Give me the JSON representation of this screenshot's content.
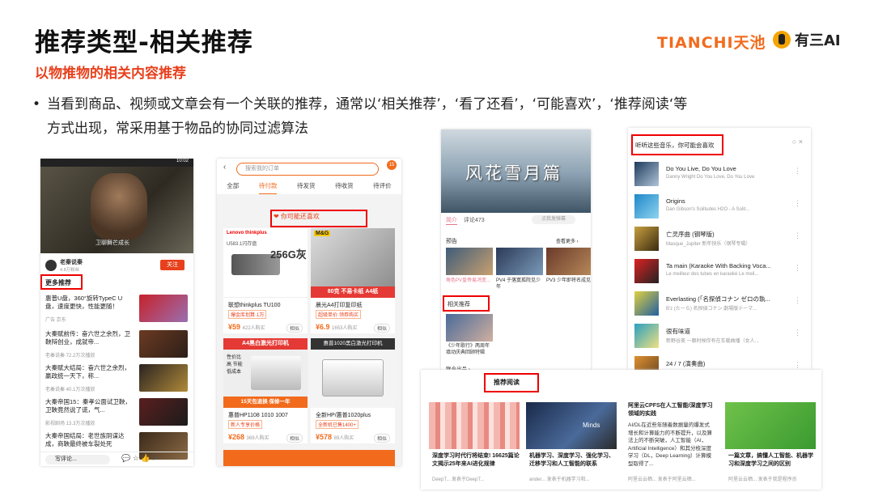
{
  "slide": {
    "title": "推荐类型-相关推荐",
    "subtitle": "以物推物的相关内容推荐",
    "logo_tianchi": "TIANCHI天池",
    "logo_yousan": "有三AI",
    "bullet_line1": "当看到商品、视频或文章会有一个关联的推荐，通常以‘相关推荐’，‘看了还看’，‘可能喜欢’，‘推荐阅读‘等",
    "bullet_line2": "方式出现，常采用基于物品的协同过滤算法"
  },
  "s1": {
    "status_time": "10:02",
    "video_caption": "卫聊舞芒成长",
    "channel": "老秦说秦",
    "followers": "4.8万粉丝",
    "follow_label": "关注",
    "section": "更多推荐",
    "rows": [
      {
        "title": "惠普U盘，360°旋转TypeC U盘，速度更快，性能更随！",
        "meta": "广告 京东"
      },
      {
        "title": "大秦赋前传：奋六世之余烈，卫鞅辩创业，成就帝...",
        "meta": "老秦说秦 72.2万次播放"
      },
      {
        "title": "大秦赋大结局：奋六世之余烈，嬴政统一天下，称...",
        "meta": "老秦说秦 40.1万次播放"
      },
      {
        "title": "大秦帝国15：秦孝公面试卫鞅，卫鞅竟然说了谎，气...",
        "meta": "影视剧场 13.3万次播放"
      },
      {
        "title": "大秦帝国结局：老世族阴谋达成，商鞅最终被车裂处死",
        "meta": ""
      }
    ],
    "comment_placeholder": "写评论..."
  },
  "s2": {
    "search_placeholder": "搜索我的订单",
    "badge": "15",
    "tabs": [
      "全部",
      "待付款",
      "待发货",
      "待收货",
      "待评价"
    ],
    "active_tab": "待付款",
    "guess_label": "你可能还喜欢",
    "cards": [
      {
        "name": "联想thinkplus TU100",
        "tag": "爆金库划算·1万",
        "price": "¥59",
        "buyers": "422人购买",
        "similar": "相似"
      },
      {
        "name": "晨光A4打印复印纸",
        "tag": "超级单价·领券购买",
        "price": "¥6.9",
        "buyers": "1653人购买",
        "similar": "相似"
      },
      {
        "name": "惠普HP1108 1010 1007",
        "tag": "新人专享价格",
        "price": "¥268",
        "buyers": "369人购买",
        "similar": "相似"
      },
      {
        "name": "全新HP/惠普1020plus",
        "tag": "全新机已售1400+",
        "price": "¥578",
        "buyers": "89人购买",
        "similar": "相似"
      }
    ],
    "img_text": {
      "c1_brand": "Lenovo thinkplus",
      "c1_cap": "256G灰",
      "c1_model": "U583.1闪存盘",
      "c2_brand": "M&G",
      "c2_cap": "80克 不易卡纸 A4纸",
      "c3_banner": "A4黑白激光打印机",
      "c3_side": "性价比高 节能 低成本",
      "c3_deal": "15天包退换 保修一年",
      "c4_banner": "惠普1020黑白激光打印机"
    }
  },
  "s3": {
    "video_title": "风花雪月篇",
    "tabs": [
      "简介",
      "评论473"
    ],
    "search": "点我发弹幕",
    "preview_label": "预告",
    "more": "查看更多 ›",
    "previews": [
      "角色PV皇帝易鸿变...",
      "PV4 于落寞孤院见少年",
      "PV3 少年即将名成见"
    ],
    "related_label": "相关推荐",
    "related_item": "《少年歌行》两周年填动庆典回顾特辑",
    "footer": "联合出品 ›"
  },
  "s4": {
    "header": "听听这些音乐，你可能会喜欢",
    "songs": [
      {
        "name": "Do You Live, Do You Love",
        "artist": "Danny Wright Do You Love, Do You Love"
      },
      {
        "name": "Origins",
        "artist": "Dan Gibson's Solitudes H2O - A Solit..."
      },
      {
        "name": "亡灵序曲 (钢琴版)",
        "artist": "Masque_Jupiter 新年快乐（钢琴专辑）"
      },
      {
        "name": "Ta main (Karaoke With Backing Voca...",
        "artist": "Le meilleur des tubes en karaoké Le meil..."
      },
      {
        "name": "Everlasting (「名探偵コナン ゼロの執...",
        "artist": "B'z (たーら) 名探偵コナン 劇場版テーマ..."
      },
      {
        "name": "很有味道",
        "artist": "新野谷美 一跟时候你有在车载曲播（女人..."
      },
      {
        "name": "24 / 7 (演奏曲)",
        "artist": ""
      }
    ],
    "controls": "○  ×"
  },
  "s5": {
    "header": "推荐阅读",
    "articles": [
      {
        "title": "深度学习时代行将结束! 16625篇论文揭示25年来AI进化规律",
        "footer": "DeepT...     发表于DeepT..."
      },
      {
        "title": "机器学习、深度学习、强化学习、迁移学习和人工智能的联系",
        "footer": "ander...     发表于机器学习和..."
      },
      {
        "title": "阿里云CPFS在人工智能/深度学习领域的实践",
        "abstract": "AI/DL在近些年随着数据量的爆发式增长和计算能力的不断提升，以及算法上的不断突破，人工智能（AI，Artificial Intelligence）和其分枝深度学习（DL，Deep Learning）计算模型取得了...",
        "footer": "阿里云云栖...     发表于阿里云栖..."
      },
      {
        "title": "一篇文章，搞懂人工智能、机器学习和深度学习之间的区别",
        "footer": "阿里云云栖...     发表于我是程序员"
      }
    ],
    "thumb_text": {
      "a2": "Minds"
    }
  }
}
